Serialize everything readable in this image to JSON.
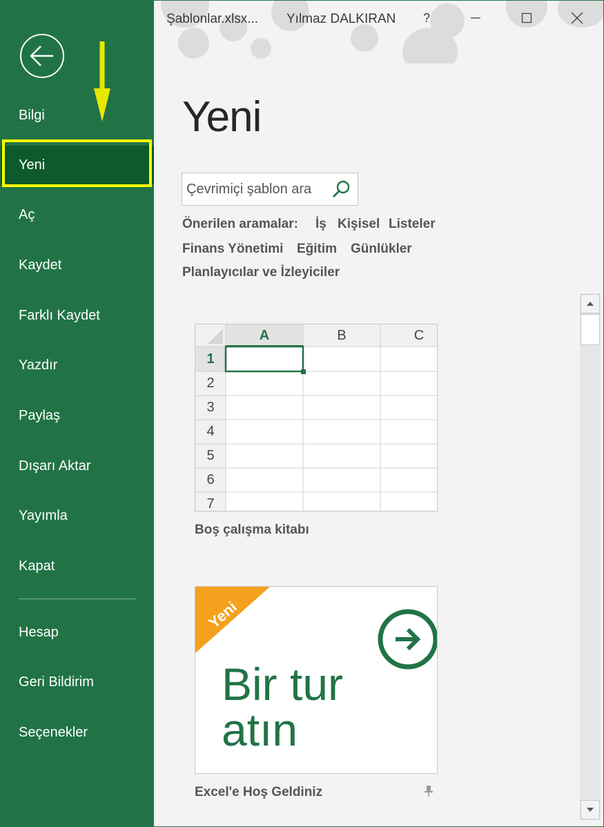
{
  "window": {
    "file_name": "Şablonlar.xlsx...",
    "user_name": "Yılmaz DALKIRAN",
    "help_label": "?"
  },
  "sidebar": {
    "items": [
      {
        "label": "Bilgi"
      },
      {
        "label": "Yeni"
      },
      {
        "label": "Aç"
      },
      {
        "label": "Kaydet"
      },
      {
        "label": "Farklı Kaydet"
      },
      {
        "label": "Yazdır"
      },
      {
        "label": "Paylaş"
      },
      {
        "label": "Dışarı Aktar"
      },
      {
        "label": "Yayımla"
      },
      {
        "label": "Kapat"
      }
    ],
    "bottom_items": [
      {
        "label": "Hesap"
      },
      {
        "label": "Geri Bildirim"
      },
      {
        "label": "Seçenekler"
      }
    ],
    "active": "Yeni",
    "accent": "#217346",
    "active_color": "#0e5a2c",
    "highlight_color": "#ffff00"
  },
  "main": {
    "title": "Yeni",
    "search": {
      "placeholder": "Çevrimiçi şablon ara"
    },
    "suggested_label": "Önerilen aramalar:",
    "suggestions": [
      "İş",
      "Kişisel",
      "Listeler",
      "Finans Yönetimi",
      "Eğitim",
      "Günlükler",
      "Planlayıcılar ve İzleyiciler"
    ],
    "templates": [
      {
        "label": "Boş çalışma kitabı",
        "columns": [
          "A",
          "B",
          "C"
        ],
        "rows": [
          "1",
          "2",
          "3",
          "4",
          "5",
          "6",
          "7"
        ]
      },
      {
        "label": "Excel'e Hoş Geldiniz",
        "badge": "Yeni",
        "tour_line1": "Bir tur",
        "tour_line2": "atın",
        "badge_color": "#f4a11d"
      }
    ]
  }
}
